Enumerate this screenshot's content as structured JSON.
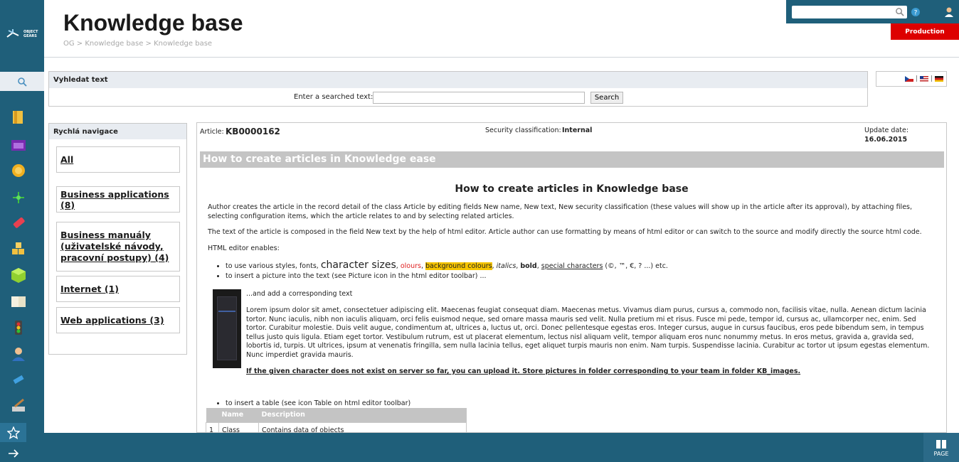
{
  "rail": {
    "logo_line1": "OBJECT",
    "logo_line2": "GEARS",
    "icons": [
      "folder-icon",
      "calendar-icon",
      "badge-icon",
      "network-icon",
      "tag-icon",
      "blocks-icon",
      "cube-icon",
      "book-icon",
      "traffic-light-icon",
      "person-icon",
      "satellite-icon",
      "tools-icon"
    ]
  },
  "header": {
    "title": "Knowledge base",
    "breadcrumb": "OG > Knowledge base > Knowledge base",
    "environment": "Production"
  },
  "search_panel": {
    "heading": "Vyhledat text",
    "label": "Enter a searched text:",
    "value": "",
    "button": "Search"
  },
  "quick_nav": {
    "heading": "Rychlá navigace",
    "items": [
      "All",
      "Business applications (8)",
      "Business manuály (uživatelské návody, pracovní postupy) (4)",
      "Internet (1)",
      "Web applications (3)"
    ]
  },
  "article": {
    "article_label": "Article:",
    "article_id": "KB0000162",
    "security_label": "Security classification:",
    "security_value": "Internal",
    "update_label": "Update date:",
    "update_value": "16.06.2015",
    "title_bar": "How to create articles in Knowledge ease",
    "heading": "How to create articles in  Knowledge base",
    "p1": "Author creates the article in the record detail of the class Article by editing fields New name, New text, New security classification (these values will show up in the article after its approval), by attaching files, selecting configuration items, which the article relates to and by selecting related articles.",
    "p2": "The text of the article is composed in the field New text by the help of html editor. Article author can use formatting by means of  html editor or can switch to the source and modify directly the source html code.",
    "p3": "HTML editor enables:",
    "b1_prefix": "to use various styles, fonts, ",
    "b1_big": "character sizes",
    "b1_sep1": ", ",
    "b1_colors": "olours",
    "b1_sep2": ", ",
    "b1_bg": "background colours",
    "b1_sep3": ", ",
    "b1_italic": "italics",
    "b1_sep4": ", ",
    "b1_bold": "bold",
    "b1_sep5": ", ",
    "b1_special": "special characters",
    "b1_suffix": " (©, ™, €, ? ...) etc.",
    "b2": "to insert a picture into the text (see Picture icon in the html editor toolbar) ...",
    "img_caption": "...and add a corresponding text",
    "lorem": "Lorem ipsum dolor sit amet, consectetuer adipiscing elit. Maecenas feugiat consequat diam. Maecenas metus. Vivamus diam purus, cursus a, commodo non, facilisis vitae, nulla. Aenean dictum lacinia tortor. Nunc iaculis, nibh non iaculis aliquam, orci felis euismod neque, sed ornare massa mauris sed velit. Nulla pretium mi et risus. Fusce mi pede, tempor id, cursus ac, ullamcorper nec, enim. Sed tortor. Curabitur molestie. Duis velit augue, condimentum at, ultrices a, luctus ut, orci. Donec pellentesque egestas eros. Integer cursus, augue in cursus faucibus, eros pede bibendum sem, in tempus tellus justo quis ligula. Etiam eget tortor. Vestibulum rutrum, est ut placerat elementum, lectus nisl aliquam velit, tempor aliquam eros nunc nonummy metus. In eros metus, gravida a, gravida sed, lobortis id, turpis. Ut ultrices, ipsum at venenatis fringilla, sem nulla lacinia tellus, eget aliquet turpis mauris non enim. Nam turpis. Suspendisse lacinia. Curabitur ac tortor ut ipsum egestas elementum. Nunc imperdiet gravida mauris.",
    "upload_note": "If the given character does not exist on server so far, you can upload it. Store pictures in folder corresponding to your team in folder KB_images.",
    "b3": "to insert a table (see icon Table on html editor toolbar)",
    "table_headers": [
      "",
      "Name",
      "Description"
    ],
    "table_rows": [
      [
        "1",
        "Class",
        "Contains data of objects"
      ]
    ]
  },
  "bottom_bar": {
    "page_label": "PAGE"
  },
  "colors": {
    "rail": "#1f5f7a",
    "env_badge": "#dd0000",
    "title_bar": "#c4c4c4",
    "highlight": "#f5c400"
  }
}
